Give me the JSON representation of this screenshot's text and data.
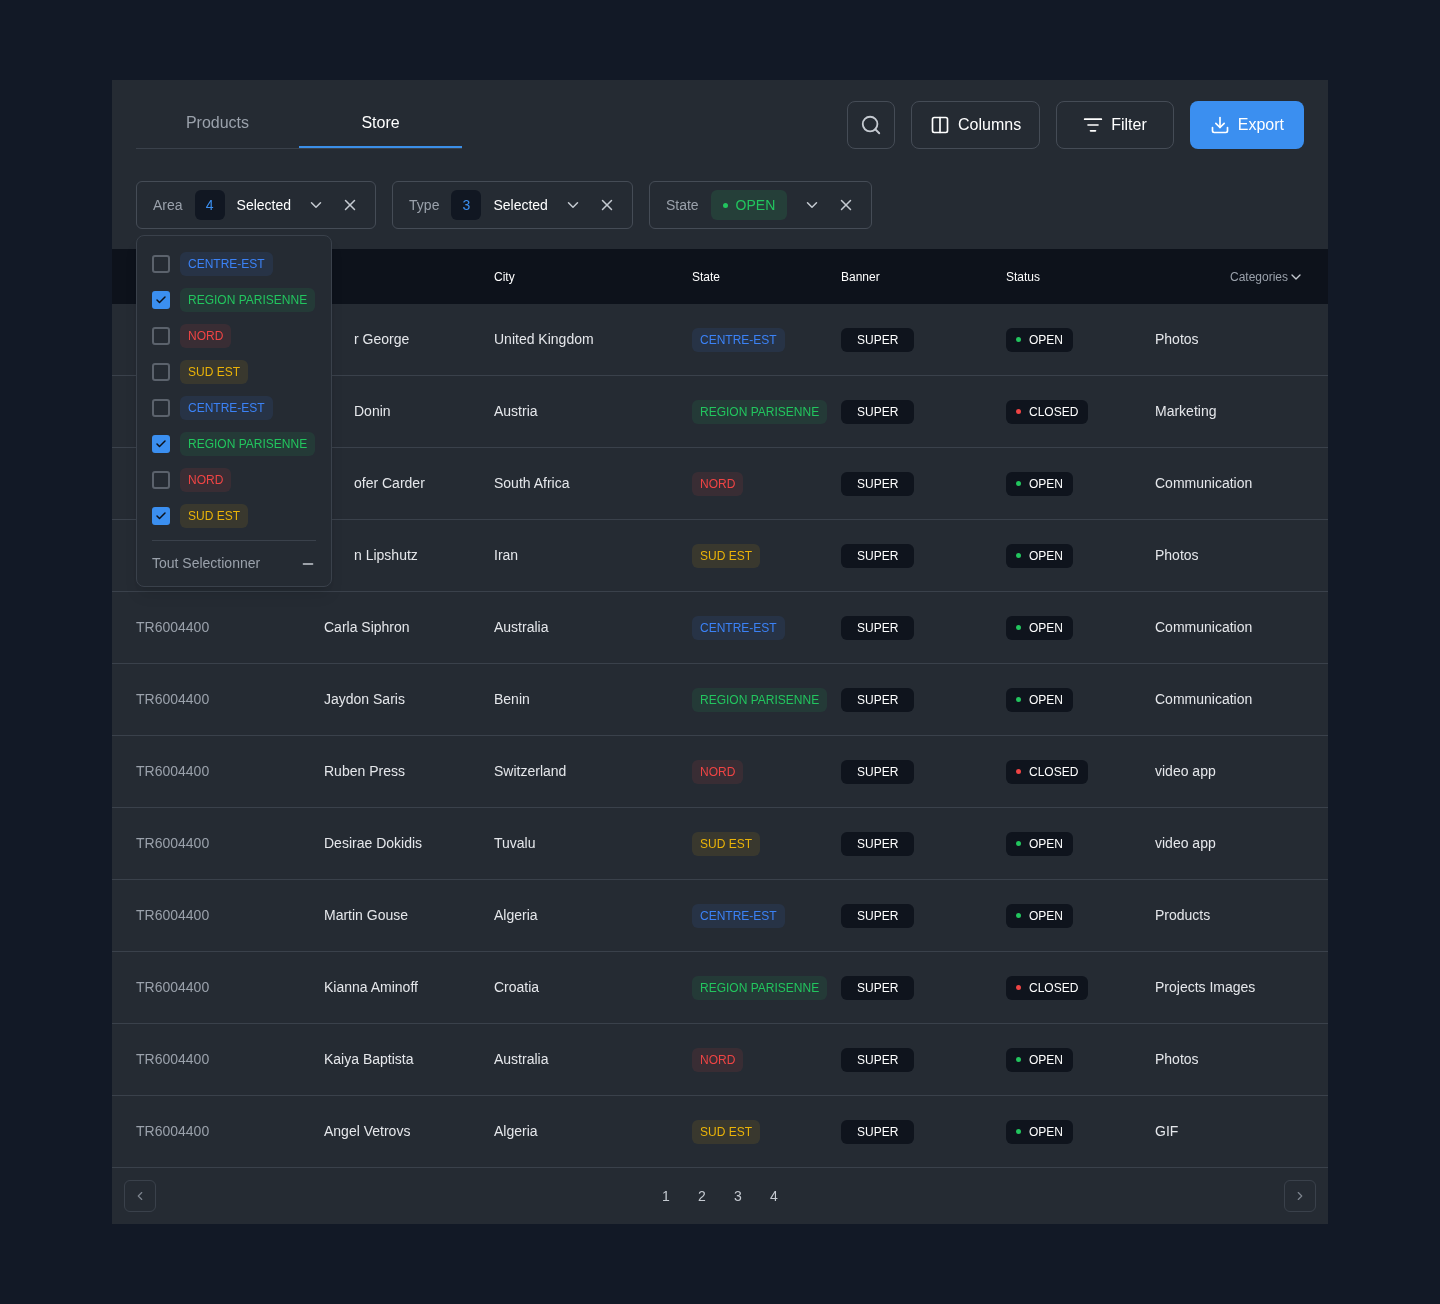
{
  "tabs": [
    {
      "label": "Products",
      "selected": false
    },
    {
      "label": "Store",
      "selected": true
    }
  ],
  "toolbar": {
    "columns": "Columns",
    "filter": "Filter",
    "export": "Export"
  },
  "filters": [
    {
      "kind": "count",
      "label": "Area",
      "count": "4",
      "value": "Selected"
    },
    {
      "kind": "count",
      "label": "Type",
      "count": "3",
      "value": "Selected"
    },
    {
      "kind": "tag",
      "label": "State",
      "value": "OPEN",
      "color": "#22c55e"
    }
  ],
  "area_dropdown": {
    "options": [
      {
        "label": "CENTRE-EST",
        "color": "#3b82f6",
        "checked": false
      },
      {
        "label": "REGION PARISENNE",
        "color": "#22c55e",
        "checked": true
      },
      {
        "label": "NORD",
        "color": "#ef4444",
        "checked": false
      },
      {
        "label": "SUD EST",
        "color": "#eab308",
        "checked": false
      },
      {
        "label": "CENTRE-EST",
        "color": "#3b82f6",
        "checked": false
      },
      {
        "label": "REGION PARISENNE",
        "color": "#22c55e",
        "checked": true
      },
      {
        "label": "NORD",
        "color": "#ef4444",
        "checked": false
      },
      {
        "label": "SUD EST",
        "color": "#eab308",
        "checked": true
      }
    ],
    "select_all": "Tout Selectionner"
  },
  "table": {
    "columns": [
      "City",
      "State",
      "Banner",
      "Status",
      "Categories"
    ],
    "rows": [
      {
        "name": "r George",
        "city": "United Kingdom",
        "state": {
          "label": "CENTRE-EST",
          "color": "#3b82f6"
        },
        "banner": "SUPER",
        "status": {
          "label": "OPEN",
          "color": "#22c55e"
        },
        "category": "Photos"
      },
      {
        "name": "Donin",
        "city": "Austria",
        "state": {
          "label": "REGION PARISENNE",
          "color": "#22c55e"
        },
        "banner": "SUPER",
        "status": {
          "label": "CLOSED",
          "color": "#ef4444"
        },
        "category": "Marketing"
      },
      {
        "name": "ofer Carder",
        "city": "South Africa",
        "state": {
          "label": "NORD",
          "color": "#ef4444"
        },
        "banner": "SUPER",
        "status": {
          "label": "OPEN",
          "color": "#22c55e"
        },
        "category": "Communication"
      },
      {
        "name": "n Lipshutz",
        "city": "Iran",
        "state": {
          "label": "SUD EST",
          "color": "#eab308"
        },
        "banner": "SUPER",
        "status": {
          "label": "OPEN",
          "color": "#22c55e"
        },
        "category": "Photos"
      },
      {
        "id": "TR6004400",
        "name": "Carla Siphron",
        "city": "Australia",
        "state": {
          "label": "CENTRE-EST",
          "color": "#3b82f6"
        },
        "banner": "SUPER",
        "status": {
          "label": "OPEN",
          "color": "#22c55e"
        },
        "category": "Communication"
      },
      {
        "id": "TR6004400",
        "name": "Jaydon Saris",
        "city": "Benin",
        "state": {
          "label": "REGION PARISENNE",
          "color": "#22c55e"
        },
        "banner": "SUPER",
        "status": {
          "label": "OPEN",
          "color": "#22c55e"
        },
        "category": "Communication"
      },
      {
        "id": "TR6004400",
        "name": "Ruben Press",
        "city": "Switzerland",
        "state": {
          "label": "NORD",
          "color": "#ef4444"
        },
        "banner": "SUPER",
        "status": {
          "label": "CLOSED",
          "color": "#ef4444"
        },
        "category": "video app"
      },
      {
        "id": "TR6004400",
        "name": "Desirae Dokidis",
        "city": "Tuvalu",
        "state": {
          "label": "SUD EST",
          "color": "#eab308"
        },
        "banner": "SUPER",
        "status": {
          "label": "OPEN",
          "color": "#22c55e"
        },
        "category": "video app"
      },
      {
        "id": "TR6004400",
        "name": "Martin Gouse",
        "city": "Algeria",
        "state": {
          "label": "CENTRE-EST",
          "color": "#3b82f6"
        },
        "banner": "SUPER",
        "status": {
          "label": "OPEN",
          "color": "#22c55e"
        },
        "category": "Products"
      },
      {
        "id": "TR6004400",
        "name": "Kianna Aminoff",
        "city": "Croatia",
        "state": {
          "label": "REGION PARISENNE",
          "color": "#22c55e"
        },
        "banner": "SUPER",
        "status": {
          "label": "CLOSED",
          "color": "#ef4444"
        },
        "category": "Projects Images"
      },
      {
        "id": "TR6004400",
        "name": "Kaiya Baptista",
        "city": "Australia",
        "state": {
          "label": "NORD",
          "color": "#ef4444"
        },
        "banner": "SUPER",
        "status": {
          "label": "OPEN",
          "color": "#22c55e"
        },
        "category": "Photos"
      },
      {
        "id": "TR6004400",
        "name": "Angel Vetrovs",
        "city": "Algeria",
        "state": {
          "label": "SUD EST",
          "color": "#eab308"
        },
        "banner": "SUPER",
        "status": {
          "label": "OPEN",
          "color": "#22c55e"
        },
        "category": "GIF"
      }
    ]
  },
  "pagination": {
    "pages": [
      "1",
      "2",
      "3",
      "4"
    ]
  }
}
